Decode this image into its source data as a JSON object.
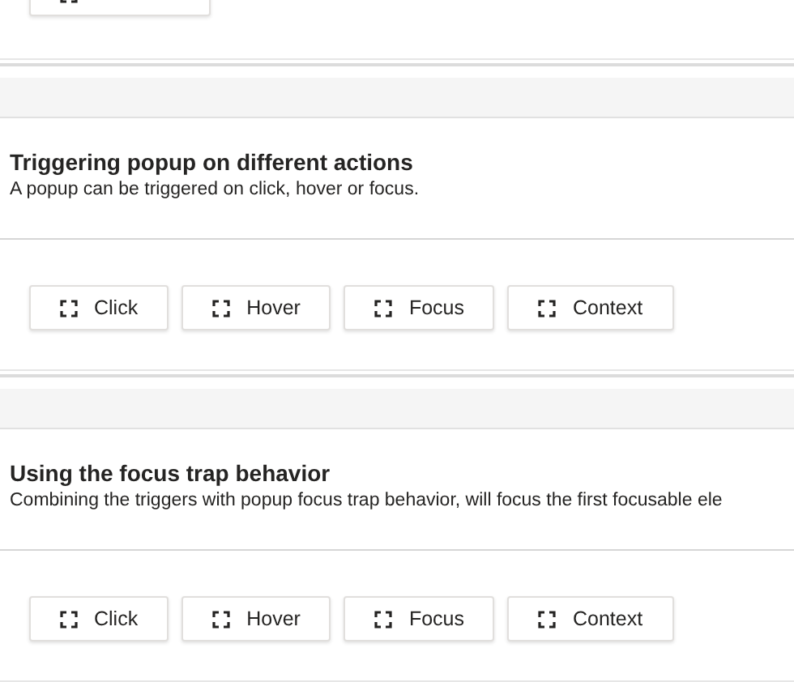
{
  "sections": [
    {
      "title": "Triggering popup on different actions",
      "description": "A popup can be triggered on click, hover or focus.",
      "buttons": [
        "Click",
        "Hover",
        "Focus",
        "Context"
      ]
    },
    {
      "title": "Using the focus trap behavior",
      "description": "Combining the triggers with popup focus trap behavior, will focus the first focusable ele",
      "buttons": [
        "Click",
        "Hover",
        "Focus",
        "Context"
      ]
    }
  ]
}
